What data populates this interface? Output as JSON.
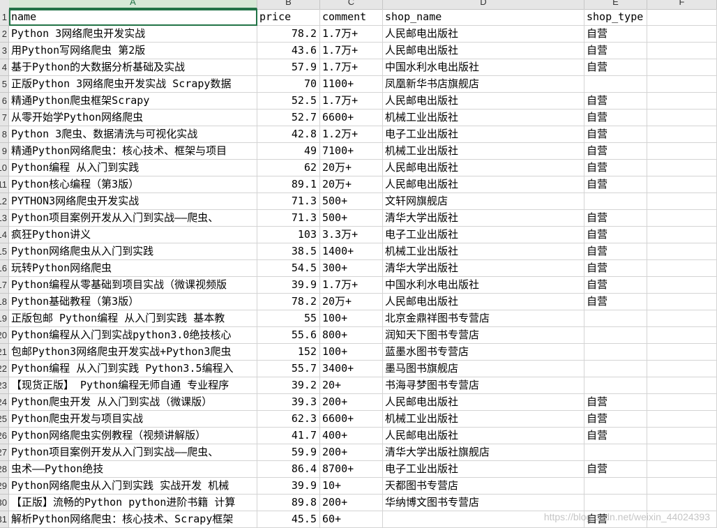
{
  "column_headers": [
    "A",
    "B",
    "C",
    "D",
    "E",
    "F"
  ],
  "selected_cell": "A1",
  "row_numbers": [
    "1",
    "2",
    "3",
    "4",
    "5",
    "6",
    "7",
    "8",
    "9",
    "10",
    "11",
    "12",
    "13",
    "14",
    "15",
    "16",
    "17",
    "18",
    "19",
    "20",
    "21",
    "22",
    "23",
    "24",
    "25",
    "26",
    "27",
    "28",
    "29",
    "30",
    "31"
  ],
  "header": [
    "name",
    "price",
    "comment",
    "shop_name",
    "shop_type"
  ],
  "rows": [
    [
      "Python 3网络爬虫开发实战",
      "78.2",
      "1.7万+",
      "人民邮电出版社",
      "自营"
    ],
    [
      "用Python写网络爬虫 第2版",
      "43.6",
      "1.7万+",
      "人民邮电出版社",
      "自营"
    ],
    [
      "基于Python的大数据分析基础及实战",
      "57.9",
      "1.7万+",
      "中国水利水电出版社",
      "自营"
    ],
    [
      "正版Python 3网络爬虫开发实战 Scrapy数据",
      "70",
      "1100+",
      "凤凰新华书店旗舰店",
      ""
    ],
    [
      "精通Python爬虫框架Scrapy",
      "52.5",
      "1.7万+",
      "人民邮电出版社",
      "自营"
    ],
    [
      "从零开始学Python网络爬虫",
      "52.7",
      "6600+",
      "机械工业出版社",
      "自营"
    ],
    [
      "Python 3爬虫、数据清洗与可视化实战",
      "42.8",
      "1.2万+",
      "电子工业出版社",
      "自营"
    ],
    [
      "精通Python网络爬虫：核心技术、框架与项目",
      "49",
      "7100+",
      "机械工业出版社",
      "自营"
    ],
    [
      "Python编程 从入门到实践",
      "62",
      "20万+",
      "人民邮电出版社",
      "自营"
    ],
    [
      "Python核心编程（第3版）",
      "89.1",
      "20万+",
      "人民邮电出版社",
      "自营"
    ],
    [
      "PYTHON3网络爬虫开发实战",
      "71.3",
      "500+",
      "文轩网旗舰店",
      ""
    ],
    [
      "Python项目案例开发从入门到实战——爬虫、",
      "71.3",
      "500+",
      "清华大学出版社",
      "自营"
    ],
    [
      "疯狂Python讲义",
      "103",
      "3.3万+",
      "电子工业出版社",
      "自营"
    ],
    [
      "Python网络爬虫从入门到实践",
      "38.5",
      "1400+",
      "机械工业出版社",
      "自营"
    ],
    [
      "玩转Python网络爬虫",
      "54.5",
      "300+",
      "清华大学出版社",
      "自营"
    ],
    [
      "Python编程从零基础到项目实战（微课视频版",
      "39.9",
      "1.7万+",
      "中国水利水电出版社",
      "自营"
    ],
    [
      "Python基础教程（第3版）",
      "78.2",
      "20万+",
      "人民邮电出版社",
      "自营"
    ],
    [
      "正版包邮 Python编程 从入门到实践 基本教",
      "55",
      "100+",
      "北京金鼎祥图书专营店",
      ""
    ],
    [
      "Python编程从入门到实战python3.0绝技核心",
      "55.6",
      "800+",
      "润知天下图书专营店",
      ""
    ],
    [
      "包邮Python3网络爬虫开发实战+Python3爬虫",
      "152",
      "100+",
      "蓝墨水图书专营店",
      ""
    ],
    [
      "Python编程 从入门到实践 Python3.5编程入",
      "55.7",
      "3400+",
      "墨马图书旗舰店",
      ""
    ],
    [
      "【现货正版】 Python编程无师自通 专业程序",
      "39.2",
      "20+",
      "书海寻梦图书专营店",
      ""
    ],
    [
      "Python爬虫开发 从入门到实战（微课版）",
      "39.3",
      "200+",
      "人民邮电出版社",
      "自营"
    ],
    [
      "Python爬虫开发与项目实战",
      "62.3",
      "6600+",
      "机械工业出版社",
      "自营"
    ],
    [
      "Python网络爬虫实例教程（视频讲解版）",
      "41.7",
      "400+",
      "人民邮电出版社",
      "自营"
    ],
    [
      "Python项目案例开发从入门到实战——爬虫、",
      "59.9",
      "200+",
      "清华大学出版社旗舰店",
      ""
    ],
    [
      "虫术——Python绝技",
      "86.4",
      "8700+",
      "电子工业出版社",
      "自营"
    ],
    [
      "Python网络爬虫从入门到实践 实战开发 机械",
      "39.9",
      "10+",
      "天都图书专营店",
      ""
    ],
    [
      "【正版】流畅的Python python进阶书籍 计算",
      "89.8",
      "200+",
      "华纳博文图书专营店",
      ""
    ],
    [
      "解析Python网络爬虫：核心技术、Scrapy框架",
      "45.5",
      "60+",
      "",
      "自营"
    ]
  ],
  "watermark": "https://blog.csdn.net/weixin_44024393"
}
